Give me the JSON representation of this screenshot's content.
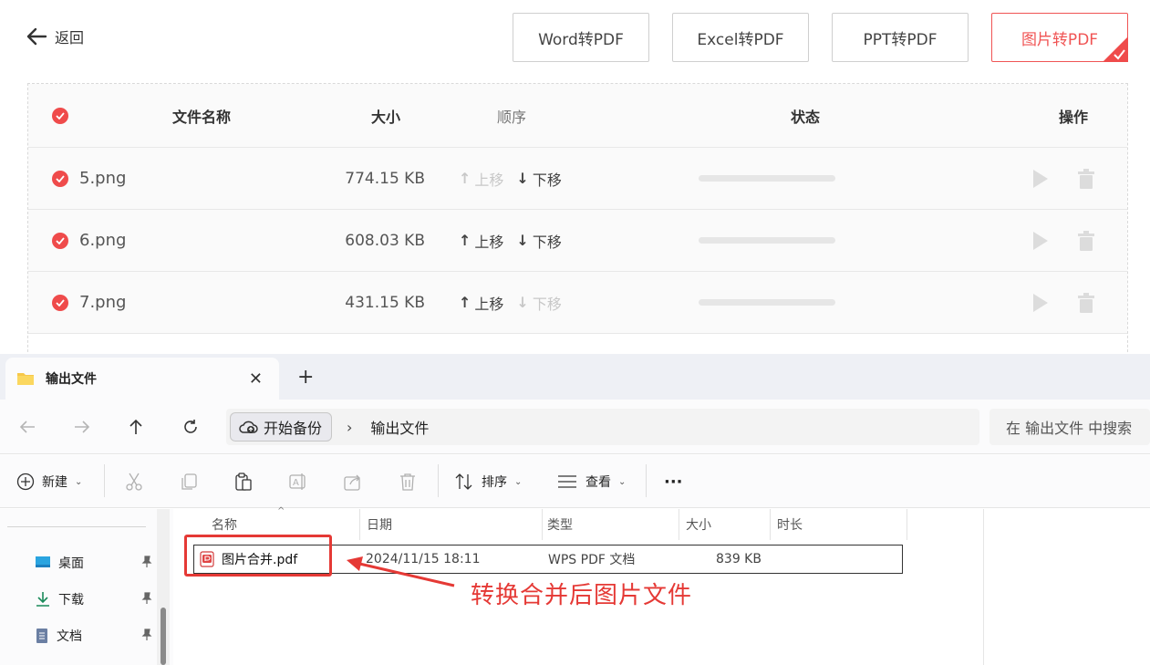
{
  "app": {
    "back_label": "返回",
    "tabs": [
      {
        "label": "Word转PDF"
      },
      {
        "label": "Excel转PDF"
      },
      {
        "label": "PPT转PDF"
      },
      {
        "label": "图片转PDF",
        "active": true
      }
    ],
    "table": {
      "headers": {
        "name": "文件名称",
        "size": "大小",
        "order": "顺序",
        "status": "状态",
        "action": "操作"
      },
      "move_up_label": "上移",
      "move_down_label": "下移",
      "rows": [
        {
          "name": "5.png",
          "size": "774.15 KB",
          "up_enabled": false,
          "down_enabled": true
        },
        {
          "name": "6.png",
          "size": "608.03 KB",
          "up_enabled": true,
          "down_enabled": true
        },
        {
          "name": "7.png",
          "size": "431.15 KB",
          "up_enabled": true,
          "down_enabled": false
        }
      ]
    },
    "accent_color": "#ef4b4b"
  },
  "explorer": {
    "tab_title": "输出文件",
    "backup_label": "开始备份",
    "breadcrumb": "输出文件",
    "search_placeholder": "在 输出文件 中搜索",
    "toolbar": {
      "new_label": "新建",
      "sort_label": "排序",
      "view_label": "查看",
      "more_label": "···"
    },
    "sidebar": [
      {
        "label": "桌面",
        "icon": "desktop-icon"
      },
      {
        "label": "下载",
        "icon": "download-icon"
      },
      {
        "label": "文档",
        "icon": "document-icon"
      }
    ],
    "columns": {
      "name": "名称",
      "date": "日期",
      "type": "类型",
      "size": "大小",
      "duration": "时长"
    },
    "files": [
      {
        "name": "图片合并.pdf",
        "date": "2024/11/15 18:11",
        "type": "WPS PDF 文档",
        "size": "839 KB",
        "icon": "pdf-icon"
      }
    ]
  },
  "annotation": {
    "text": "转换合并后图片文件",
    "color": "#e53935"
  }
}
